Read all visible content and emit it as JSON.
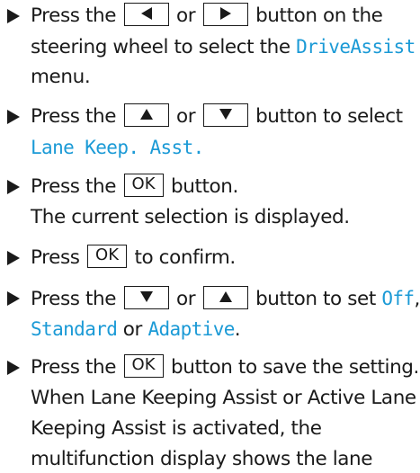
{
  "colors": {
    "text": "#1a1a1a",
    "display_text": "#1b9ad6"
  },
  "icons": {
    "bullet": "right-pointing-triangle",
    "left": "left-arrow-key",
    "right": "right-arrow-key",
    "up": "up-arrow-key",
    "down": "down-arrow-key"
  },
  "steps": [
    {
      "line1_prefix": "Press the",
      "line1_mid": "or",
      "line1_suffix": "button on the",
      "line2_text": "steering wheel to select the",
      "line2_display": "DriveAssist",
      "line3_text": "menu."
    },
    {
      "line1_prefix": "Press the",
      "line1_mid": "or",
      "line1_suffix": "button to select",
      "line2_display": "Lane Keep. Asst."
    },
    {
      "line1_prefix": "Press the",
      "key_label": "OK",
      "line1_suffix": "button.",
      "line2_text": "The current selection is displayed."
    },
    {
      "line1_prefix": "Press",
      "key_label": "OK",
      "line1_suffix": "to confirm."
    },
    {
      "line1_prefix": "Press the",
      "line1_mid": "or",
      "line1_suffix": "button to set",
      "line1_display": "Off",
      "line1_comma": ",",
      "line2_display_a": "Standard",
      "line2_text": "or",
      "line2_display_b": "Adaptive",
      "line2_period": "."
    },
    {
      "line1_prefix": "Press the",
      "key_label": "OK",
      "line1_suffix": "button to save the setting.",
      "line2_text": "When Lane Keeping Assist or Active Lane",
      "line3_text": "Keeping Assist is activated, the",
      "line4_text": "multifunction display shows the lane"
    }
  ]
}
